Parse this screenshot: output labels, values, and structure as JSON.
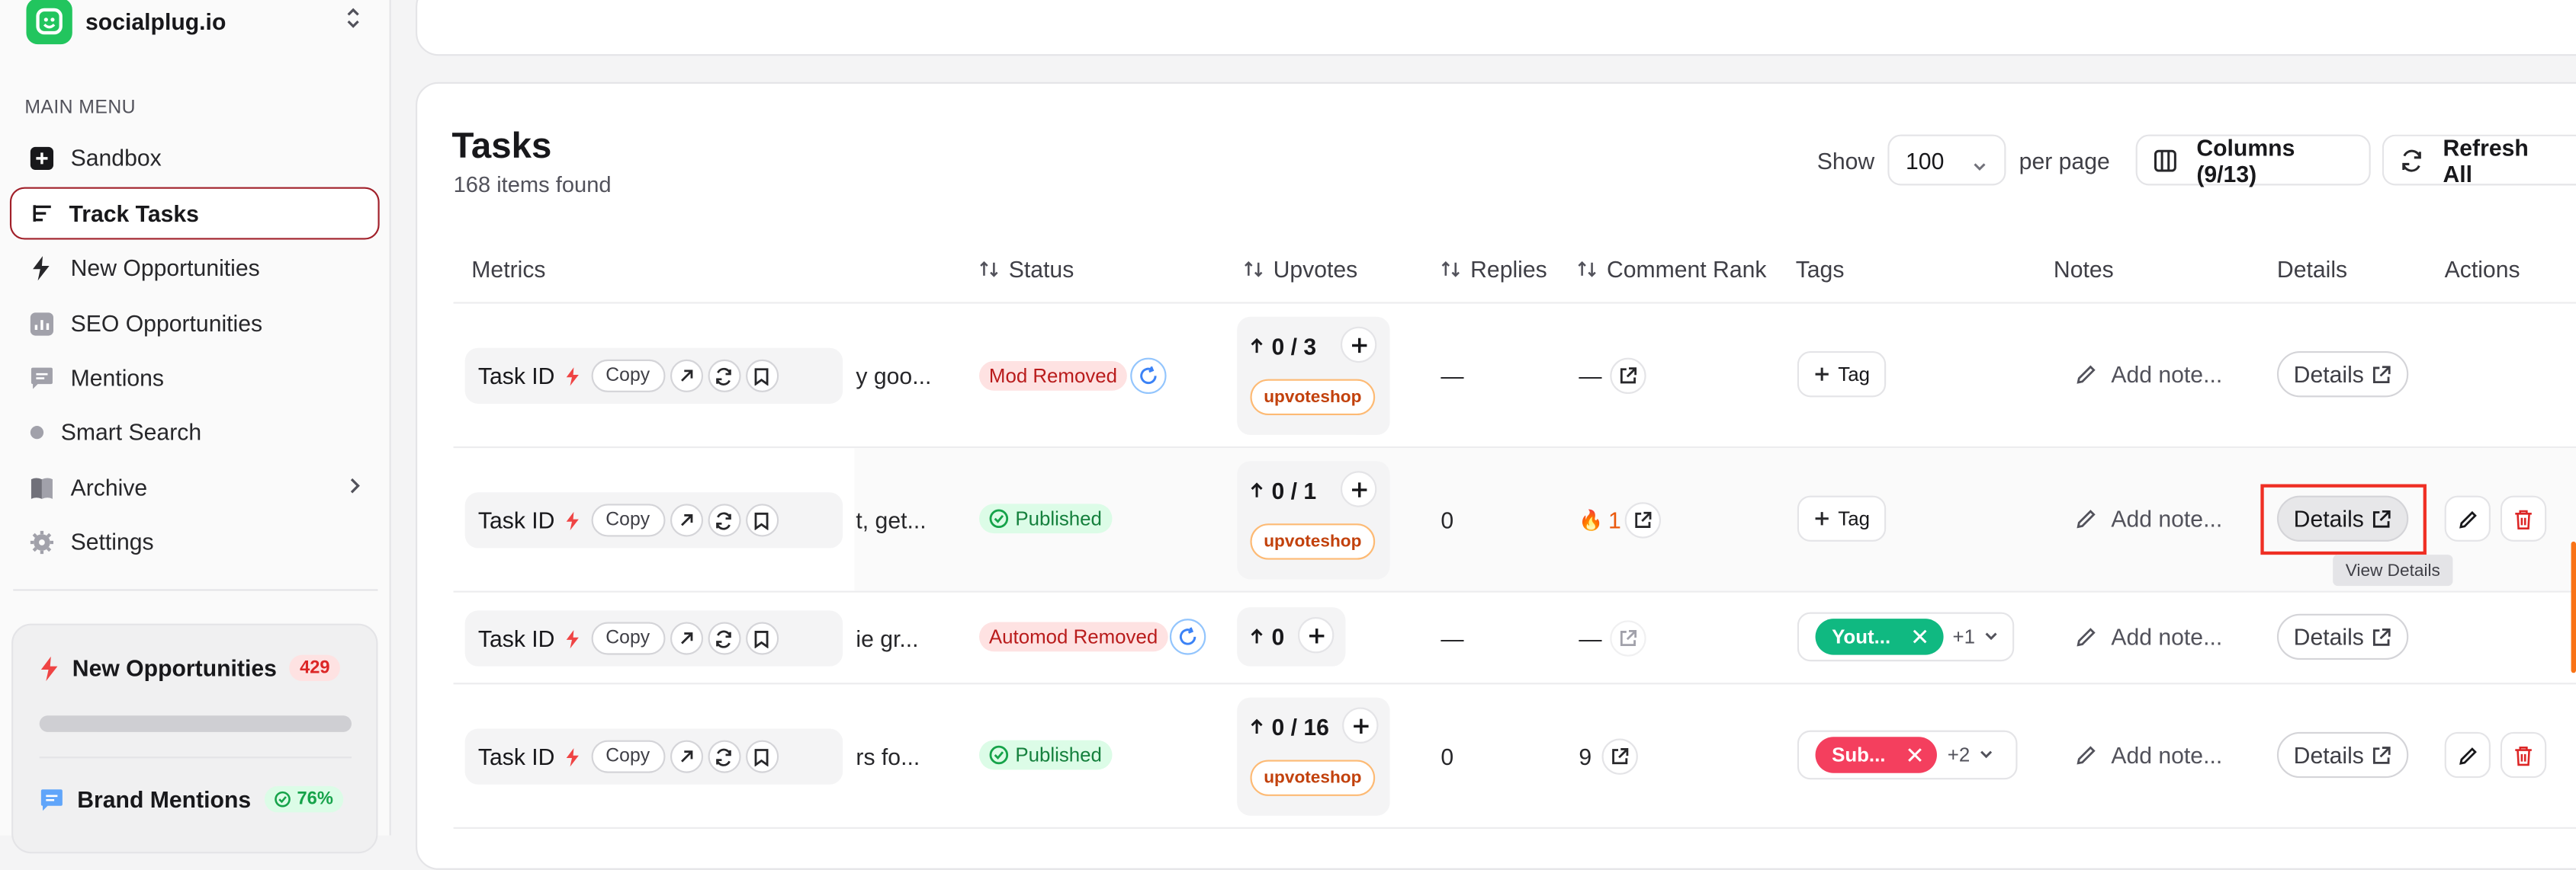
{
  "brand": {
    "name": "socialplug.io"
  },
  "menu": {
    "label": "MAIN MENU",
    "items": [
      {
        "label": "Sandbox",
        "icon": "plus-square-icon"
      },
      {
        "label": "Track Tasks",
        "icon": "list-icon"
      },
      {
        "label": "New Opportunities",
        "icon": "bolt-icon"
      },
      {
        "label": "SEO Opportunities",
        "icon": "bar-chart-icon"
      },
      {
        "label": "Mentions",
        "icon": "message-icon"
      },
      {
        "label": "Smart Search",
        "icon": "search-dot-icon"
      },
      {
        "label": "Archive",
        "icon": "book-icon"
      },
      {
        "label": "Settings",
        "icon": "gear-icon"
      }
    ]
  },
  "side_card": {
    "opps_label": "New Opportunities",
    "opps_count": "429",
    "mentions_label": "Brand Mentions",
    "mentions_pct": "76%"
  },
  "tasks": {
    "title": "Tasks",
    "count_text": "168 items found",
    "show_label": "Show",
    "per_page_value": "100",
    "per_page_label": "per page",
    "columns_label": "Columns (9/13)",
    "refresh_label": "Refresh All"
  },
  "columns": {
    "metrics": "Metrics",
    "status": "Status",
    "upvotes": "Upvotes",
    "replies": "Replies",
    "comment_rank": "Comment Rank",
    "tags": "Tags",
    "notes": "Notes",
    "details": "Details",
    "actions": "Actions"
  },
  "row_common": {
    "task_id": "Task ID",
    "copy": "Copy",
    "add_note": "Add note...",
    "details": "Details",
    "tag": "Tag",
    "shop": "upvoteshop"
  },
  "rows": [
    {
      "snippet": "y goo...",
      "status": "Mod Removed",
      "upvotes": "0 / 3",
      "replies": "—",
      "rank": "—"
    },
    {
      "snippet": "t, get...",
      "status": "Published",
      "upvotes": "0 / 1",
      "replies": "0",
      "rank": "1"
    },
    {
      "snippet": "ie gr...",
      "status": "Automod Removed",
      "upvotes": "0",
      "replies": "—",
      "rank": "—",
      "tag": "Yout...",
      "tag_more": "+1",
      "tag_color": "#10b981"
    },
    {
      "snippet": "rs fo...",
      "status": "Published",
      "upvotes": "0 / 16",
      "replies": "0",
      "rank": "9",
      "tag": "Sub...",
      "tag_more": "+2",
      "tag_color": "#f43f5e"
    }
  ],
  "tooltip": "View Details",
  "colors": {
    "accent_red": "#ef2f24",
    "green": "#22c55e"
  }
}
